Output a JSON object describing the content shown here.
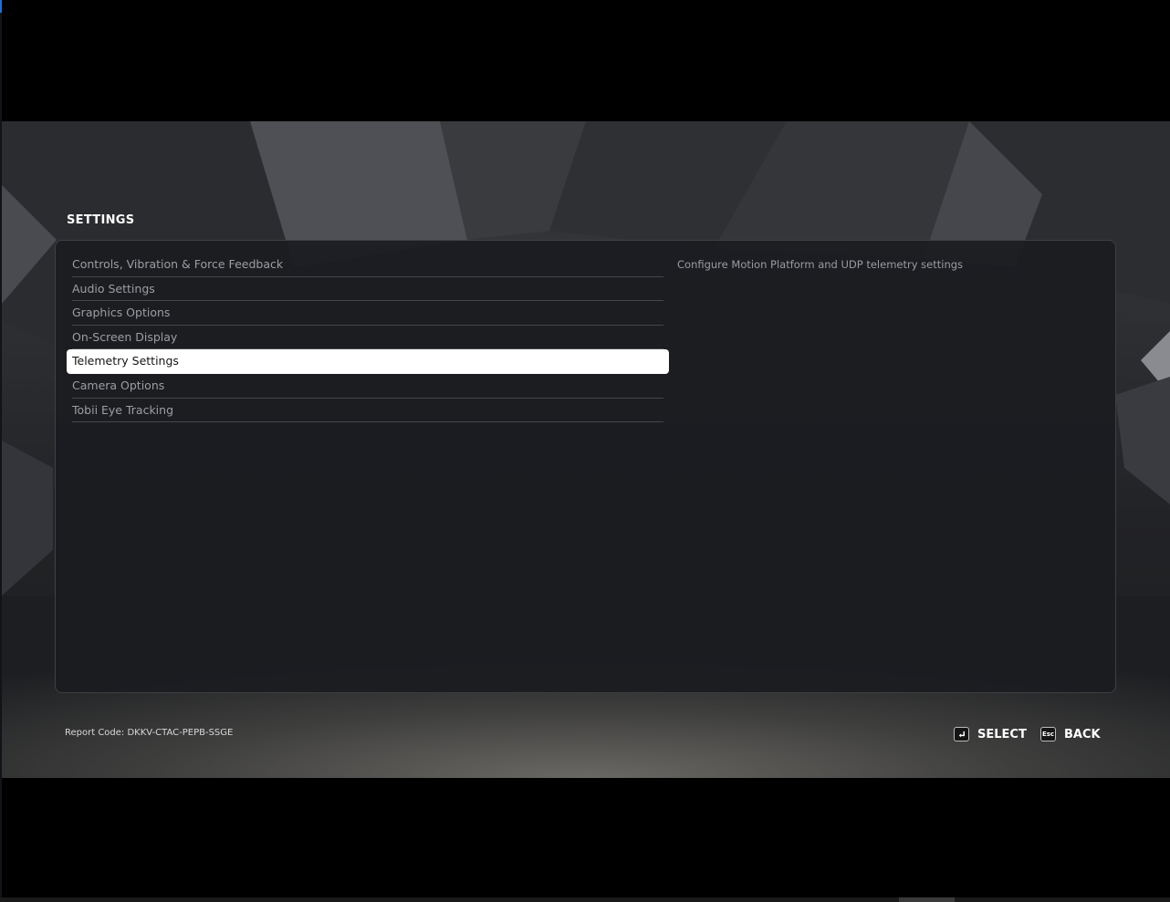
{
  "settings": {
    "title": "SETTINGS",
    "menu": [
      {
        "label": "Controls, Vibration & Force Feedback",
        "selected": false
      },
      {
        "label": "Audio Settings",
        "selected": false
      },
      {
        "label": "Graphics Options",
        "selected": false
      },
      {
        "label": "On-Screen Display",
        "selected": false
      },
      {
        "label": "Telemetry Settings",
        "selected": true
      },
      {
        "label": "Camera Options",
        "selected": false
      },
      {
        "label": "Tobii Eye Tracking",
        "selected": false
      }
    ],
    "description": "Configure Motion Platform and UDP telemetry settings"
  },
  "footer": {
    "report_code": "Report Code: DKKV-CTAC-PEPB-SSGE",
    "select_icon": "enter-key-icon",
    "select_label": "SELECT",
    "back_key_label": "Esc",
    "back_label": "BACK"
  },
  "colors": {
    "selected_bg": "#ffffff",
    "menu_text": "#9c9ea3",
    "title_text": "#ffffff"
  }
}
